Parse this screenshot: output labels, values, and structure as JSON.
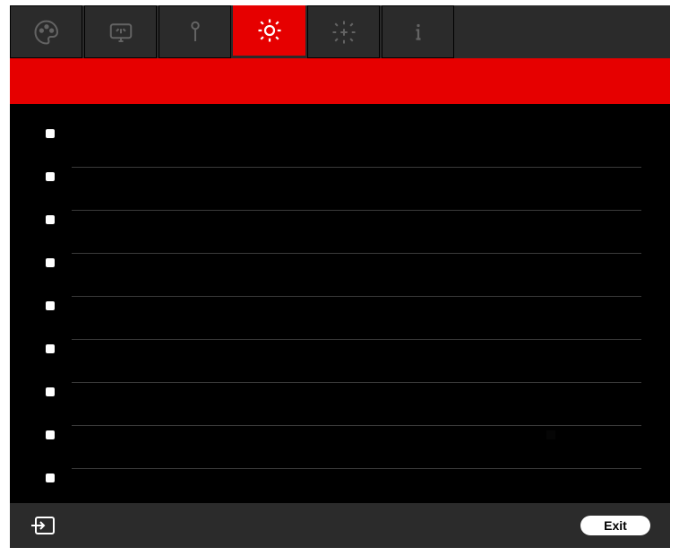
{
  "tabs": [
    {
      "id": "palette",
      "icon": "palette",
      "selected": false
    },
    {
      "id": "display",
      "icon": "display",
      "selected": false
    },
    {
      "id": "wrench",
      "icon": "wrench",
      "selected": false
    },
    {
      "id": "settings",
      "icon": "gear",
      "selected": true
    },
    {
      "id": "add",
      "icon": "gear-plus",
      "selected": false
    },
    {
      "id": "info",
      "icon": "info",
      "selected": false
    }
  ],
  "header": {
    "title": ""
  },
  "rows": [
    {
      "label": "",
      "value": ""
    },
    {
      "label": "",
      "value": ""
    },
    {
      "label": "",
      "value": ""
    },
    {
      "label": "",
      "value": ""
    },
    {
      "label": "",
      "value": ""
    },
    {
      "label": "",
      "value": ""
    },
    {
      "label": "",
      "value": ""
    },
    {
      "label": "",
      "value": "",
      "hasValueDot": true
    },
    {
      "label": "",
      "value": ""
    }
  ],
  "footer": {
    "exit_label": "Exit"
  },
  "colors": {
    "accent": "#e60000",
    "panel": "#2b2b2b",
    "body": "#000000"
  }
}
